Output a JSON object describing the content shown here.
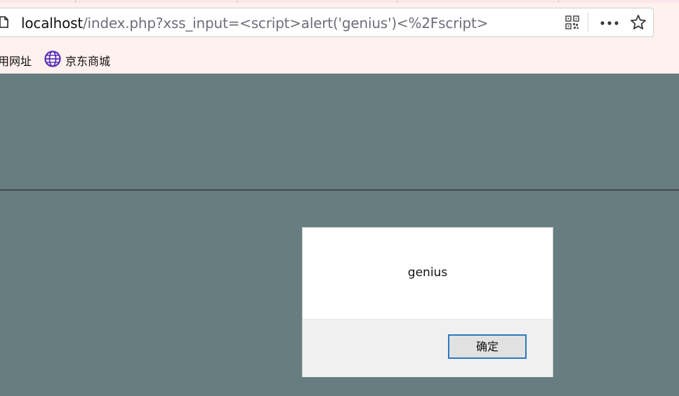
{
  "browser": {
    "url": {
      "host": "localhost",
      "path": "/index.php?xss_input=<script>alert('genius')<%2Fscript>"
    },
    "icons": {
      "page": "page-icon",
      "qr": "qr-code-icon",
      "more": "more-icon",
      "bookmark_star": "star-icon"
    },
    "bookmarks": [
      {
        "label": "用网址",
        "icon": null
      },
      {
        "label": "京东商城",
        "icon": "globe-icon"
      }
    ]
  },
  "dialog": {
    "message": "genius",
    "ok_label": "确定"
  },
  "colors": {
    "page_background": "#677d7f",
    "toolbar_background": "#fff1ee",
    "focus_border": "#2b79c2"
  }
}
